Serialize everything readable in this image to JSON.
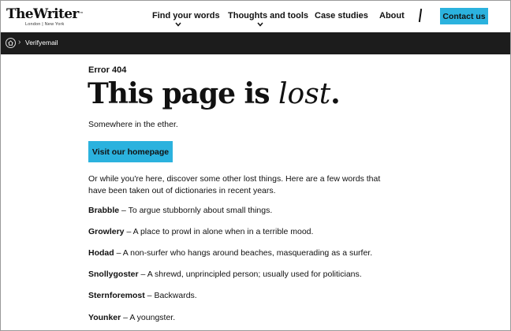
{
  "header": {
    "logo_main": "TheWriter",
    "logo_tm": "™",
    "logo_sub": "London  |  New York",
    "nav": [
      {
        "label": "Find your words",
        "has_dropdown": true
      },
      {
        "label": "Thoughts and tools",
        "has_dropdown": true
      },
      {
        "label": "Case studies",
        "has_dropdown": false
      },
      {
        "label": "About",
        "has_dropdown": false
      }
    ],
    "contact_label": "Contact us"
  },
  "breadcrumb": {
    "separator": "›",
    "current": "Verifyemail"
  },
  "main": {
    "error_code": "Error 404",
    "title_main": "This page is ",
    "title_script": "lost",
    "title_end": ".",
    "subtitle": "Somewhere in the ether.",
    "homepage_button": "Visit our homepage",
    "intro": "Or while you're here, discover some other lost things. Here are a few words that have been taken out of dictionaries in recent years.",
    "words": [
      {
        "term": "Brabble",
        "definition": " – To argue stubbornly about small things."
      },
      {
        "term": "Growlery",
        "definition": " – A place to prowl in alone when in a terrible mood."
      },
      {
        "term": "Hodad",
        "definition": " – A non-surfer who hangs around beaches, masquerading as a surfer."
      },
      {
        "term": "Snollygoster",
        "definition": " – A shrewd, unprincipled person; usually used for politicians."
      },
      {
        "term": "Sternforemost",
        "definition": " – Backwards."
      },
      {
        "term": "Younker",
        "definition": " – A youngster."
      }
    ]
  },
  "colors": {
    "accent": "#2bb2de",
    "bar": "#1c1c1c"
  }
}
